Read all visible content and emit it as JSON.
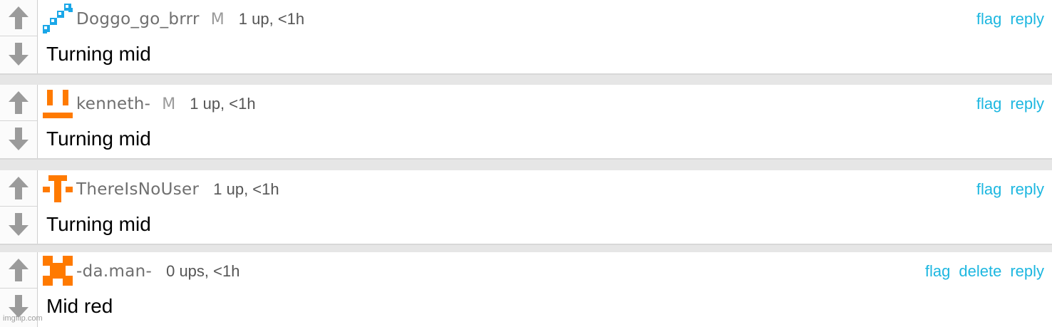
{
  "comments": [
    {
      "username": "Doggo_go_brrr",
      "mod_badge": "M",
      "stats": "1 up, <1h",
      "text": "Turning mid",
      "avatar_icon": "pixel-diagonal-avatar-icon",
      "avatar_color": "#1aa7e8",
      "actions": [
        "flag",
        "reply"
      ]
    },
    {
      "username": "kenneth-",
      "mod_badge": "M",
      "stats": "1 up, <1h",
      "text": "Turning mid",
      "avatar_icon": "pixel-face-avatar-icon",
      "avatar_color": "#ff7a00",
      "actions": [
        "flag",
        "reply"
      ]
    },
    {
      "username": "ThereIsNoUser",
      "mod_badge": "",
      "stats": "1 up, <1h",
      "text": "Turning mid",
      "avatar_icon": "pixel-cross-avatar-icon",
      "avatar_color": "#ff7a00",
      "actions": [
        "flag",
        "reply"
      ]
    },
    {
      "username": "-da.man-",
      "mod_badge": "",
      "stats": "0 ups, <1h",
      "text": "Mid red",
      "avatar_icon": "pixel-x-avatar-icon",
      "avatar_color": "#ff7a00",
      "actions": [
        "flag",
        "delete",
        "reply"
      ]
    }
  ],
  "colors": {
    "action_link": "#1db7e0",
    "arrow": "#9b9b9b"
  },
  "watermark": "imgflip.com"
}
